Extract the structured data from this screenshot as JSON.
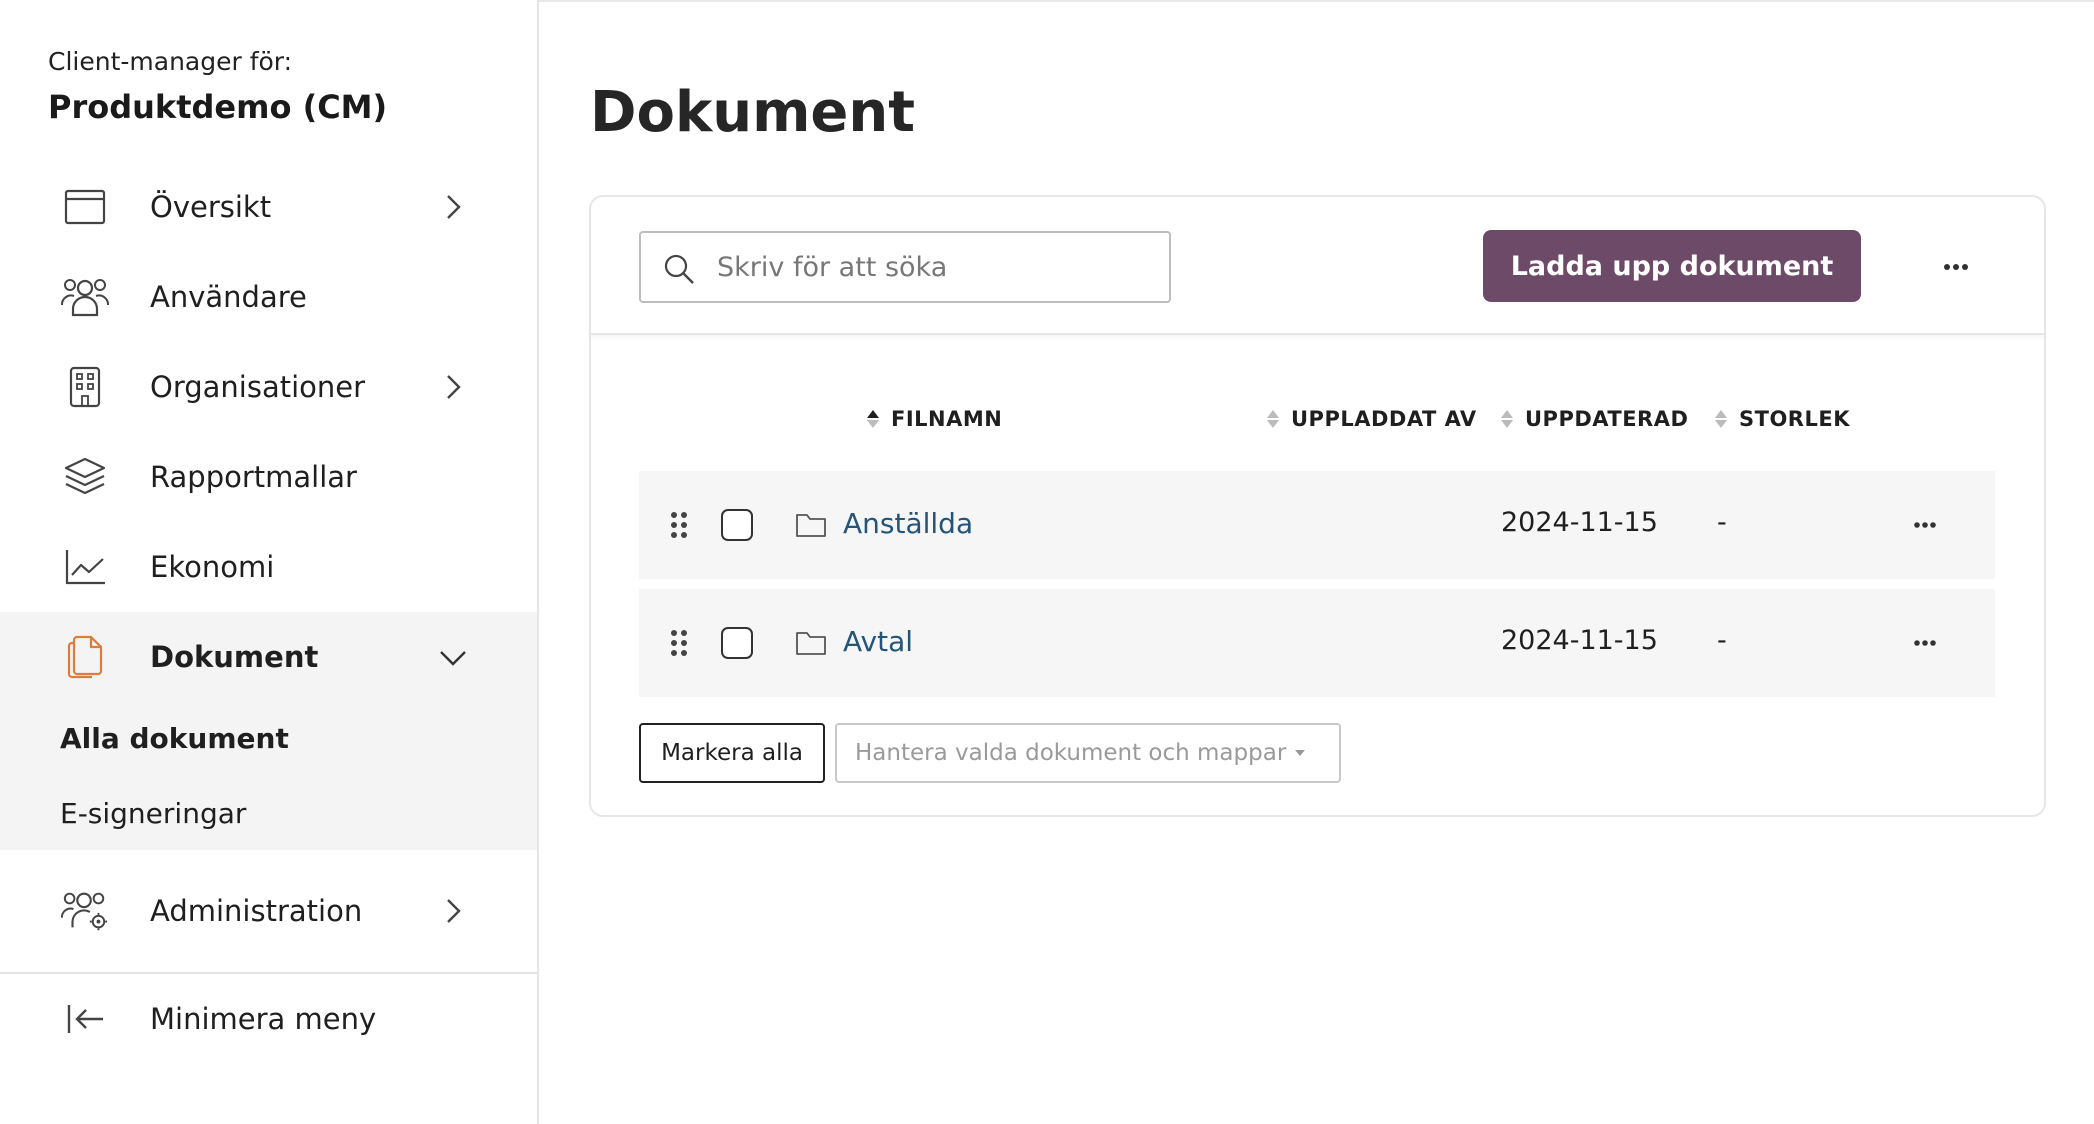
{
  "sidebar": {
    "client_label": "Client-manager för:",
    "client_name": "Produktdemo (CM)",
    "items": [
      {
        "label": "Översikt",
        "icon": "window-icon"
      },
      {
        "label": "Användare",
        "icon": "users-icon"
      },
      {
        "label": "Organisationer",
        "icon": "building-icon"
      },
      {
        "label": "Rapportmallar",
        "icon": "layers-icon"
      },
      {
        "label": "Ekonomi",
        "icon": "chart-line-icon"
      },
      {
        "label": "Dokument",
        "icon": "documents-icon"
      },
      {
        "label": "Administration",
        "icon": "users-gear-icon"
      }
    ],
    "sub_items": [
      {
        "label": "Alla dokument"
      },
      {
        "label": "E-signeringar"
      }
    ],
    "collapse_label": "Minimera meny"
  },
  "main": {
    "title": "Dokument",
    "search_placeholder": "Skriv för att söka",
    "upload_label": "Ladda upp dokument",
    "columns": {
      "filename": "FILNAMN",
      "uploaded_by": "UPPLADDAT AV",
      "updated": "UPPDATERAD",
      "size": "STORLEK"
    },
    "rows": [
      {
        "name": "Anställda",
        "uploaded_by": "",
        "updated": "2024-11-15",
        "size": "-"
      },
      {
        "name": "Avtal",
        "uploaded_by": "",
        "updated": "2024-11-15",
        "size": "-"
      }
    ],
    "mark_all_label": "Markera alla",
    "manage_label": "Hantera valda dokument och mappar"
  },
  "colors": {
    "accent": "#6d4b68",
    "link": "#245478",
    "active_icon": "#e07b39"
  }
}
